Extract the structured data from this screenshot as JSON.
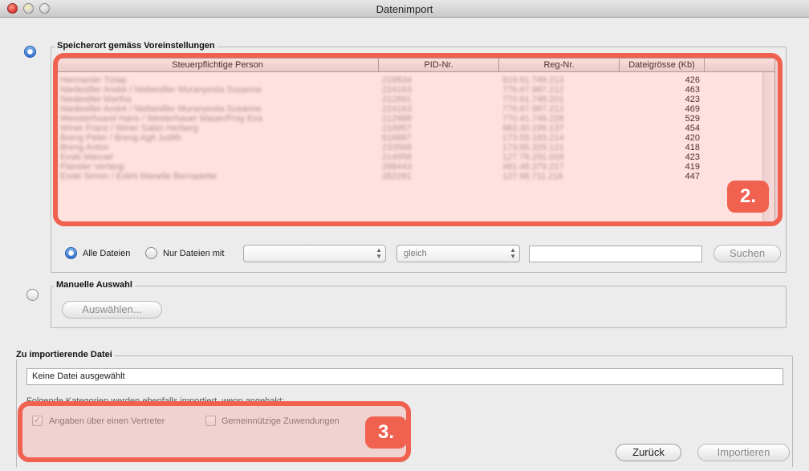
{
  "window": {
    "title": "Datenimport"
  },
  "source_group": {
    "legend": "Speicherort gemäss Voreinstellungen",
    "table": {
      "columns": [
        "Steuerpflichtige Person",
        "PID-Nr.",
        "Reg-Nr.",
        "Dateigrösse (Kb)"
      ],
      "rows": [
        {
          "person": "Hermanier Tiziap",
          "pid": "218834",
          "reg": "819.91.749.213",
          "size": "426"
        },
        {
          "person": "Niedesiller André / Niebesiller Muranyesta Susanne",
          "pid": "224163",
          "reg": "776.67.987.212",
          "size": "463"
        },
        {
          "person": "Niedesiller Martha",
          "pid": "212891",
          "reg": "770.61.749.201",
          "size": "423"
        },
        {
          "person": "Niedesiller André / Niebesiller Muranyesta Susanne",
          "pid": "224163",
          "reg": "776.67.987.212",
          "size": "469"
        },
        {
          "person": "Wessterhsarel Hans / Westerhauer Mauer/Fray Eva",
          "pid": "212988",
          "reg": "770.41.749.228",
          "size": "529"
        },
        {
          "person": "Winer Franz / Winer Sabin Herberg",
          "pid": "218857",
          "reg": "983.30.199.137",
          "size": "454"
        },
        {
          "person": "Breng Peter / Breng Agit Judith",
          "pid": "618887",
          "reg": "173.55.183.214",
          "size": "420"
        },
        {
          "person": "Breng Anton",
          "pid": "233568",
          "reg": "173.85.329.121",
          "size": "418"
        },
        {
          "person": "Exski Manuel",
          "pid": "214958",
          "reg": "127.78.291.009",
          "size": "423"
        },
        {
          "person": "Flansler Verlang",
          "pid": "288443",
          "reg": "481.48.379.217",
          "size": "419"
        },
        {
          "person": "Exski Simon / Exkhi Manelle Bernadette",
          "pid": "282281",
          "reg": "127.98.711.216",
          "size": "447"
        }
      ]
    },
    "filter": {
      "all_files_label": "Alle Dateien",
      "only_files_label": "Nur Dateien mit",
      "field_select_value": "",
      "operator_select_value": "gleich",
      "search_value": "",
      "search_button": "Suchen"
    }
  },
  "manual_group": {
    "legend": "Manuelle Auswahl",
    "choose_button": "Auswählen..."
  },
  "import_group": {
    "legend": "Zu importierende Datei",
    "file_value": "Keine Datei ausgewählt",
    "categories_text": "Folgende Kategorien werden ebenfalls importiert, wenn angehakt:",
    "checkbox_representative": "Angaben über einen Vertreter",
    "checkbox_donations": "Gemeinnützige Zuwendungen"
  },
  "footer": {
    "back_button": "Zurück",
    "import_button": "Importieren"
  },
  "annotations": {
    "badge_2": "2.",
    "badge_3": "3."
  },
  "colors": {
    "accent": "#2f6fd0",
    "highlight": "#f0614f"
  }
}
